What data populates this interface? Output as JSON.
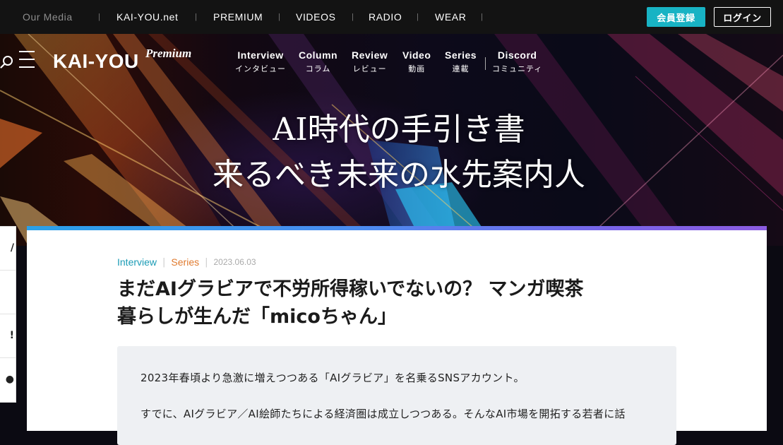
{
  "topbar": {
    "our_media": "Our Media",
    "links": [
      "KAI-YOU.net",
      "PREMIUM",
      "VIDEOS",
      "RADIO",
      "WEAR"
    ],
    "register_label": "会員登録",
    "login_label": "ログイン"
  },
  "header": {
    "logo": "KAI-YOU",
    "logo_badge": "Premium",
    "nav": [
      {
        "en": "Interview",
        "ja": "インタビュー"
      },
      {
        "en": "Column",
        "ja": "コラム"
      },
      {
        "en": "Review",
        "ja": "レビュー"
      },
      {
        "en": "Video",
        "ja": "動画"
      },
      {
        "en": "Series",
        "ja": "連載"
      },
      {
        "en": "Discord",
        "ja": "コミュニティ"
      }
    ]
  },
  "hero": {
    "line1": "AI時代の手引き書",
    "line2": "来るべき未来の水先案内人"
  },
  "side_panel": {
    "glyphs": [
      "/",
      "",
      "!",
      "●"
    ]
  },
  "article": {
    "category": "Interview",
    "series": "Series",
    "date": "2023.06.03",
    "title_line1": "まだAIグラビアで不労所得稼いでないの？ マンガ喫茶",
    "title_line2": "暮らしが生んだ「micoちゃん」",
    "lead_p1": "2023年春頃より急激に増えつつある「AIグラビア」を名乗るSNSアカウント。",
    "lead_p2": "すでに、AIグラビア／AI絵師たちによる経済圏は成立しつつある。そんなAI市場を開拓する若者に話"
  },
  "colors": {
    "accent_teal": "#18b3c4",
    "interview_color": "#1a9bb5",
    "series_color": "#e07a2e"
  }
}
